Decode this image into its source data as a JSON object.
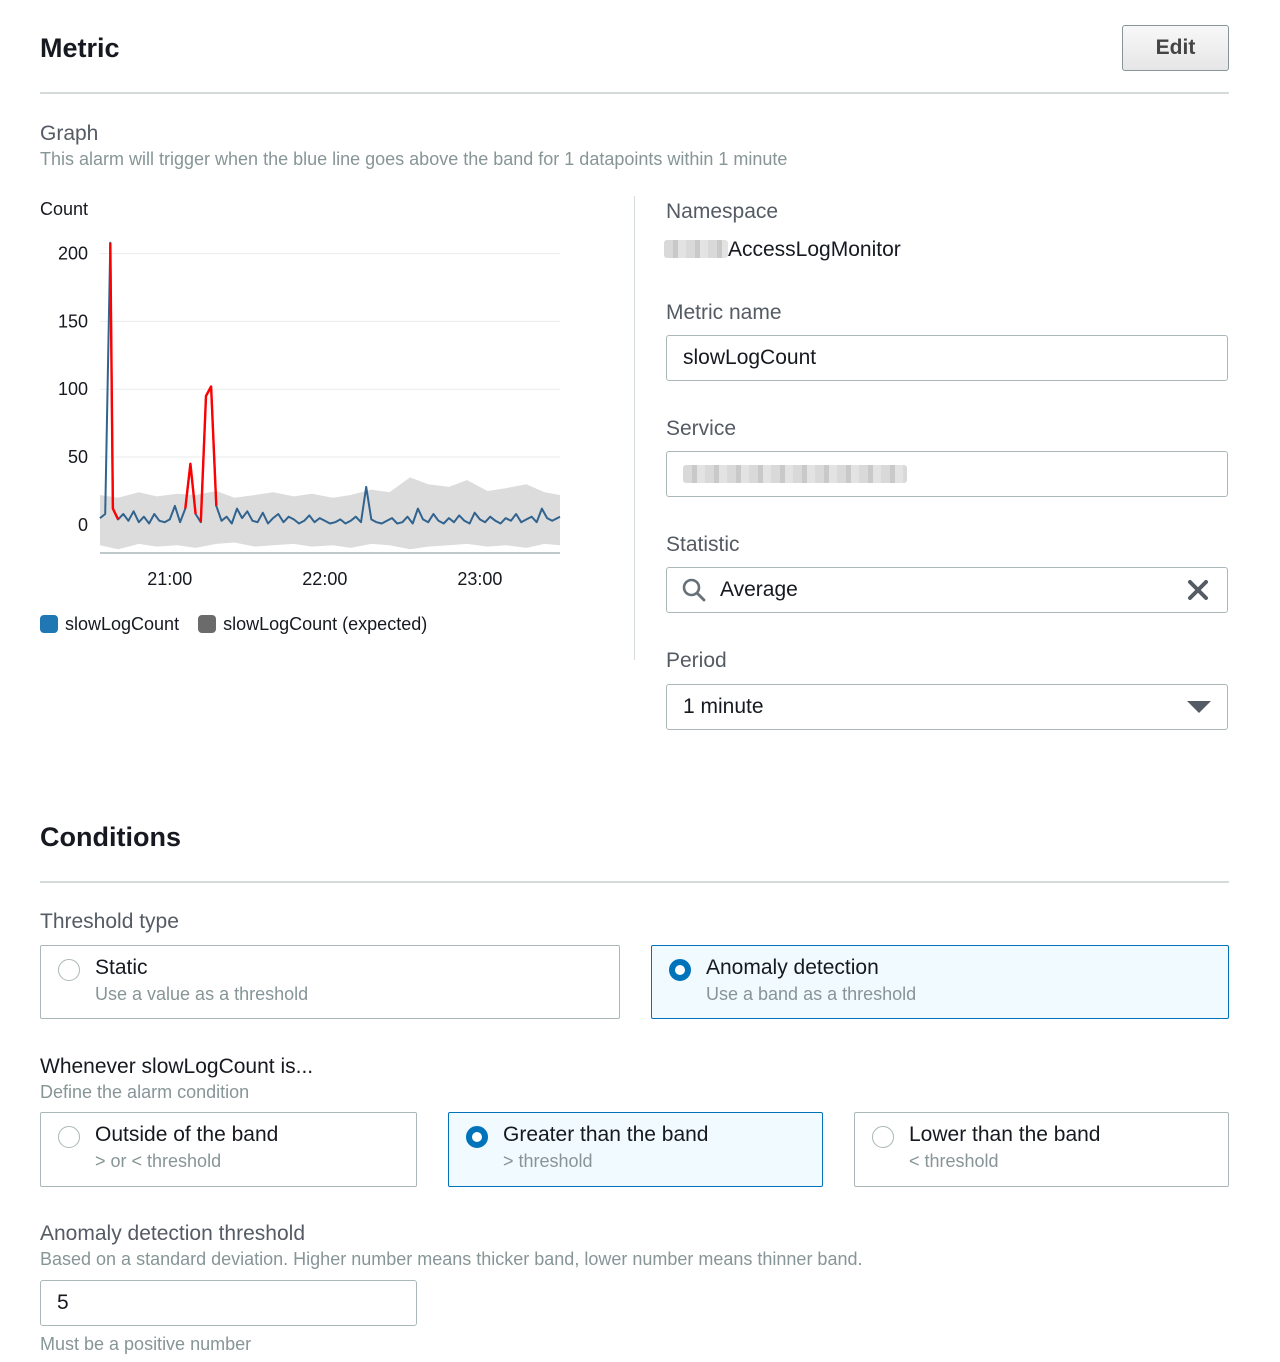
{
  "metric": {
    "title": "Metric",
    "edit_label": "Edit",
    "graph": {
      "label": "Graph",
      "description": "This alarm will trigger when the blue line goes above the band for 1 datapoints within 1 minute"
    },
    "namespace": {
      "label": "Namespace",
      "value": "AccessLogMonitor"
    },
    "metric_name": {
      "label": "Metric name",
      "value": "slowLogCount"
    },
    "service": {
      "label": "Service"
    },
    "statistic": {
      "label": "Statistic",
      "value": "Average",
      "search_icon": "search-icon",
      "clear_icon": "close-icon"
    },
    "period": {
      "label": "Period",
      "value": "1 minute",
      "dropdown_icon": "caret-down-icon"
    }
  },
  "conditions": {
    "title": "Conditions",
    "threshold_type": {
      "label": "Threshold type",
      "options": [
        {
          "title": "Static",
          "subtitle": "Use a value as a threshold",
          "selected": false
        },
        {
          "title": "Anomaly detection",
          "subtitle": "Use a band as a threshold",
          "selected": true
        }
      ]
    },
    "whenever": {
      "label": "Whenever slowLogCount is...",
      "description": "Define the alarm condition",
      "options": [
        {
          "title": "Outside of the band",
          "subtitle": "> or < threshold",
          "selected": false
        },
        {
          "title": "Greater than the band",
          "subtitle": "> threshold",
          "selected": true
        },
        {
          "title": "Lower than the band",
          "subtitle": "< threshold",
          "selected": false
        }
      ]
    },
    "anomaly_threshold": {
      "label": "Anomaly detection threshold",
      "description": "Based on a standard deviation. Higher number means thicker band, lower number means thinner band.",
      "value": "5",
      "hint": "Must be a positive number"
    }
  },
  "colors": {
    "accent": "#0073bb",
    "metric_line": "#31638f",
    "breach_line": "#ff0000",
    "band_fill": "#dcdcdc"
  },
  "chart_data": {
    "type": "line",
    "ylabel": "Count",
    "ylim": [
      -20,
      210
    ],
    "yticks": [
      0,
      50,
      100,
      150,
      200
    ],
    "xlim": [
      "20:33",
      "23:31"
    ],
    "xticks": [
      "21:00",
      "22:00",
      "23:00"
    ],
    "grid": true,
    "legend_position": "bottom-left",
    "series": [
      {
        "name": "slowLogCount",
        "color": "#1f77b4",
        "x": [
          "20:33",
          "20:35",
          "20:37",
          "20:38",
          "20:40",
          "20:42",
          "20:44",
          "20:46",
          "20:48",
          "20:50",
          "20:52",
          "20:54",
          "20:56",
          "20:58",
          "21:00",
          "21:02",
          "21:04",
          "21:06",
          "21:08",
          "21:10",
          "21:12",
          "21:14",
          "21:16",
          "21:18",
          "21:20",
          "21:22",
          "21:24",
          "21:26",
          "21:28",
          "21:30",
          "21:32",
          "21:34",
          "21:36",
          "21:38",
          "21:40",
          "21:42",
          "21:44",
          "21:46",
          "21:48",
          "21:50",
          "21:52",
          "21:54",
          "21:56",
          "21:58",
          "22:00",
          "22:02",
          "22:04",
          "22:06",
          "22:08",
          "22:10",
          "22:12",
          "22:14",
          "22:16",
          "22:18",
          "22:20",
          "22:22",
          "22:24",
          "22:26",
          "22:28",
          "22:30",
          "22:32",
          "22:34",
          "22:36",
          "22:38",
          "22:40",
          "22:42",
          "22:44",
          "22:46",
          "22:48",
          "22:50",
          "22:52",
          "22:54",
          "22:56",
          "22:58",
          "23:00",
          "23:02",
          "23:04",
          "23:06",
          "23:08",
          "23:10",
          "23:12",
          "23:14",
          "23:16",
          "23:18",
          "23:20",
          "23:22",
          "23:24",
          "23:26",
          "23:28",
          "23:31"
        ],
        "y": [
          5,
          8,
          208,
          12,
          4,
          8,
          3,
          10,
          2,
          6,
          1,
          8,
          3,
          2,
          4,
          14,
          2,
          12,
          45,
          8,
          2,
          95,
          102,
          14,
          3,
          6,
          1,
          12,
          5,
          10,
          3,
          2,
          9,
          1,
          5,
          8,
          2,
          6,
          4,
          1,
          3,
          7,
          2,
          5,
          3,
          1,
          2,
          4,
          1,
          3,
          6,
          2,
          28,
          4,
          2,
          1,
          3,
          5,
          1,
          2,
          6,
          1,
          12,
          4,
          2,
          8,
          3,
          1,
          5,
          2,
          7,
          3,
          1,
          9,
          4,
          2,
          6,
          3,
          1,
          5,
          3,
          8,
          2,
          4,
          6,
          2,
          12,
          5,
          3,
          6
        ]
      },
      {
        "name": "slowLogCount (expected)",
        "color": "#6b6b6b",
        "x": [
          "20:33",
          "20:40",
          "20:48",
          "20:55",
          "21:03",
          "21:10",
          "21:18",
          "21:25",
          "21:33",
          "21:40",
          "21:48",
          "21:55",
          "22:03",
          "22:10",
          "22:18",
          "22:25",
          "22:33",
          "22:40",
          "22:48",
          "22:55",
          "23:03",
          "23:10",
          "23:18",
          "23:25",
          "23:31"
        ],
        "y_low": [
          -15,
          -18,
          -14,
          -16,
          -15,
          -17,
          -14,
          -13,
          -16,
          -15,
          -14,
          -16,
          -15,
          -17,
          -14,
          -15,
          -18,
          -16,
          -15,
          -14,
          -16,
          -15,
          -17,
          -14,
          -15
        ],
        "y_high": [
          22,
          20,
          24,
          21,
          23,
          22,
          25,
          20,
          22,
          24,
          21,
          23,
          20,
          22,
          26,
          24,
          35,
          30,
          28,
          33,
          25,
          27,
          30,
          24,
          22
        ]
      }
    ],
    "breach_color": "#ff0000",
    "breaches": [
      {
        "from": "20:37",
        "to": "20:40"
      },
      {
        "from": "21:06",
        "to": "21:10"
      },
      {
        "from": "21:12",
        "to": "21:18"
      }
    ]
  }
}
